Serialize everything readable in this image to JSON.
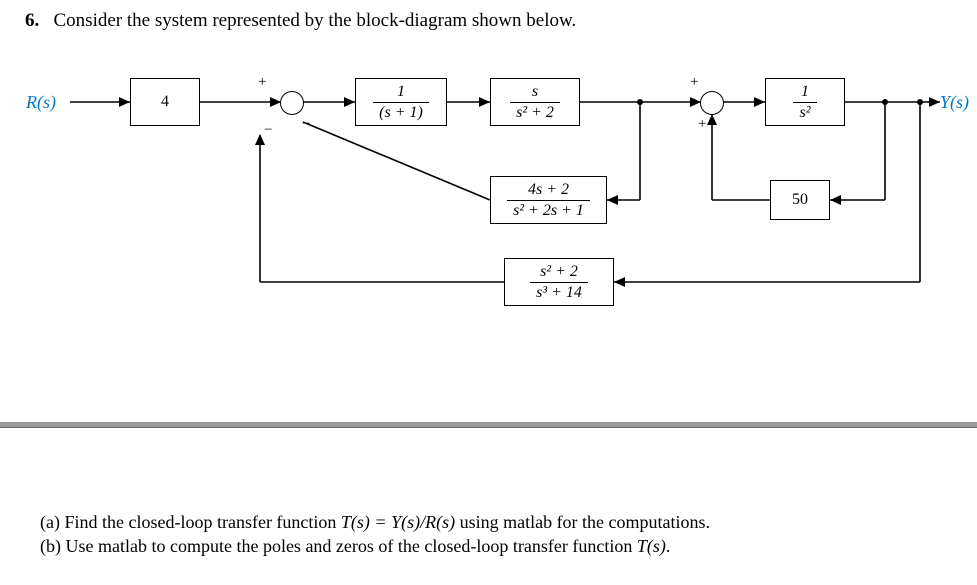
{
  "question": {
    "number": "6.",
    "prompt": "Consider the system represented by the block-diagram shown below."
  },
  "diagram": {
    "input_label": "R(s)",
    "output_label": "Y(s)",
    "blocks": {
      "g0": {
        "plain": "4"
      },
      "g1": {
        "num": "1",
        "den": "(s + 1)"
      },
      "g2": {
        "num": "s",
        "den": "s² + 2"
      },
      "g3": {
        "num": "1",
        "den": "s²"
      },
      "h1": {
        "num": "4s + 2",
        "den": "s² + 2s + 1"
      },
      "h3": {
        "plain": "50"
      },
      "h2": {
        "num": "s² + 2",
        "den": "s³ + 14"
      }
    },
    "signs": {
      "sum1_top": "+",
      "sum1_bot_a": "−",
      "sum1_bot_b": "−",
      "sum2_top": "+",
      "sum2_bot": "+"
    }
  },
  "parts": {
    "a_label": "(a)",
    "a_text_pre": "Find the closed-loop transfer function ",
    "a_tf": "T(s) = Y(s)/R(s)",
    "a_text_post": " using matlab for the computations.",
    "b_label": "(b)",
    "b_text_pre": "Use matlab to compute the poles and zeros of the closed-loop transfer function ",
    "b_tf": "T(s)",
    "b_text_post": "."
  }
}
